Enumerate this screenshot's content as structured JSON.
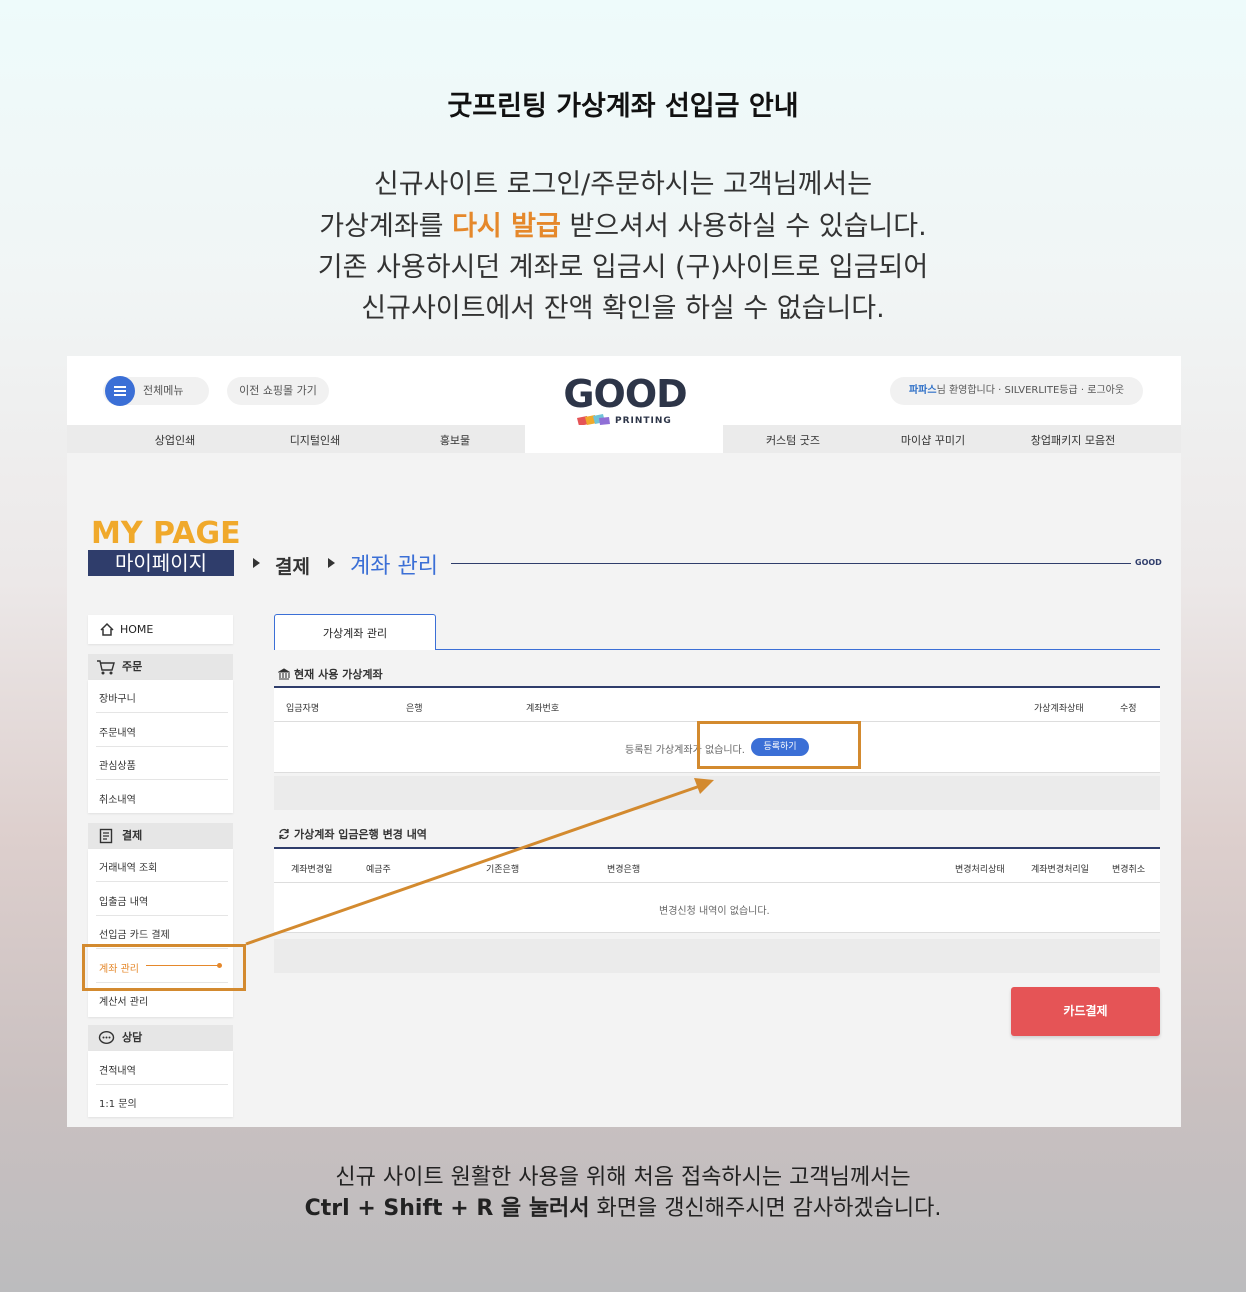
{
  "header": {
    "title": "굿프린팅 가상계좌 선입금 안내",
    "intro_line1": "신규사이트 로그인/주문하시는 고객님께서는",
    "intro_line2_pre": "가상계좌를 ",
    "intro_line2_accent": "다시 발급",
    "intro_line2_post": " 받으셔서 사용하실 수 있습니다.",
    "intro_line3": "기존 사용하시던 계좌로 입금시 (구)사이트로 입금되어",
    "intro_line4": "신규사이트에서 잔액 확인을 하실 수 없습니다."
  },
  "site": {
    "menu_label": "전체메뉴",
    "prev_mall_label": "이전 쇼핑몰 가기",
    "logo_text": "GOOD",
    "logo_sub": "PRINTING",
    "user_name": "파파스",
    "user_welcome": "님 환영합니다 · SILVERLITE등급 · 로그아웃",
    "nav": [
      "상업인쇄",
      "디지털인쇄",
      "홍보물",
      "커스텀 굿즈",
      "마이샵 꾸미기",
      "창업패키지 모음전"
    ]
  },
  "page": {
    "mypage_en": "MY PAGE",
    "mypage_ko": "마이페이지",
    "crumb1": "결제",
    "crumb2": "계좌 관리",
    "crumb_tag": "GOOD"
  },
  "sidebar": {
    "home": "HOME",
    "order_head": "주문",
    "order_items": [
      "장바구니",
      "주문내역",
      "관심상품",
      "취소내역"
    ],
    "pay_head": "결제",
    "pay_items": [
      "거래내역 조회",
      "입출금 내역",
      "선입금 카드 결제",
      "계좌 관리",
      "계산서 관리"
    ],
    "consult_head": "상담",
    "consult_items": [
      "견적내역",
      "1:1 문의"
    ]
  },
  "main": {
    "tab_label": "가상계좌 관리",
    "current_title": "현재 사용 가상계좌",
    "current_cols": [
      "입금자명",
      "은행",
      "계좌번호",
      "가상계좌상태",
      "수정"
    ],
    "current_empty": "등록된 가상계좌가 없습니다.",
    "register_btn": "등록하기",
    "history_title": "가상계좌 입금은행 변경 내역",
    "history_cols": [
      "계좌변경일",
      "예금주",
      "기존은행",
      "변경은행",
      "변경처리상태",
      "계좌변경처리일",
      "변경취소"
    ],
    "history_empty": "변경신청 내역이 없습니다.",
    "card_btn": "카드결제"
  },
  "footer": {
    "line1": "신규 사이트 원활한 사용을 위해 처음 접속하시는 고객님께서는",
    "line2_bold": "Ctrl + Shift + R 을 눌러서",
    "line2_rest": " 화면을 갱신해주시면 감사하겠습니다."
  },
  "colors": {
    "accent": "#e5882b",
    "blue": "#3b6fd6",
    "navy": "#2f3d6b",
    "red": "#e55456"
  },
  "icons": [
    "menu-icon",
    "home-icon",
    "cart-icon",
    "receipt-icon",
    "chat-icon",
    "bank-icon",
    "swap-icon"
  ]
}
